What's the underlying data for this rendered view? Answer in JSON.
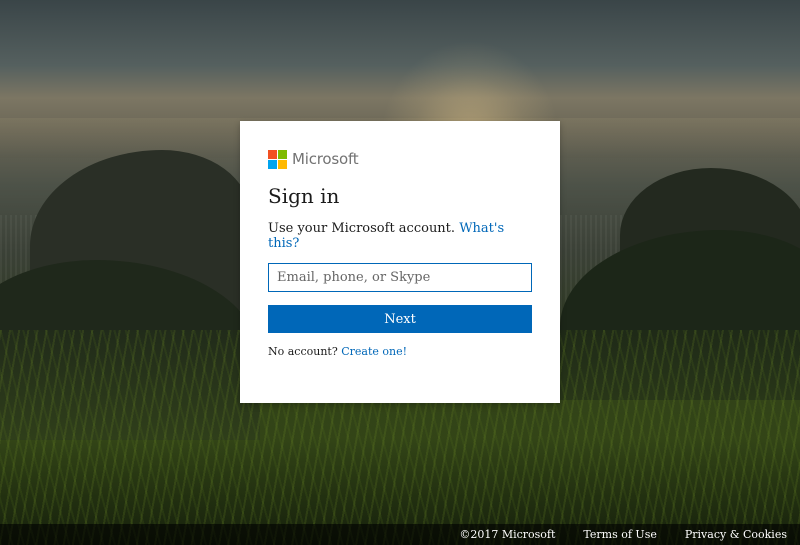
{
  "brand": {
    "name": "Microsoft",
    "logo_colors": [
      "#f25022",
      "#7fba00",
      "#00a4ef",
      "#ffb900"
    ]
  },
  "signin": {
    "title": "Sign in",
    "subtitle": "Use your Microsoft account.",
    "whats_this_link": "What's this?",
    "email_placeholder": "Email, phone, or Skype",
    "email_value": "",
    "next_button": "Next",
    "no_account_text": "No account?",
    "create_link": "Create one!"
  },
  "footer": {
    "copyright": "©2017 Microsoft",
    "terms": "Terms of Use",
    "privacy": "Privacy & Cookies"
  },
  "colors": {
    "accent": "#0067b8",
    "card_bg": "#ffffff",
    "text": "#1b1b1b"
  }
}
